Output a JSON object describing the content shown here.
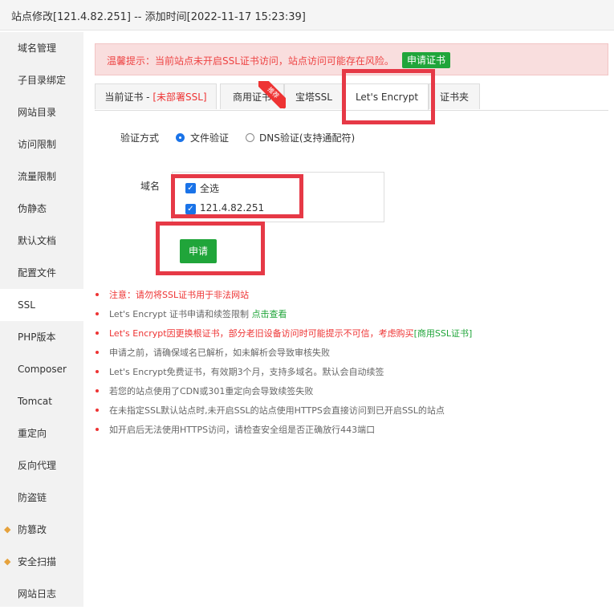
{
  "window": {
    "title": "站点修改[121.4.82.251] -- 添加时间[2022-11-17 15:23:39]"
  },
  "sidebar": {
    "items": [
      {
        "label": "域名管理"
      },
      {
        "label": "子目录绑定"
      },
      {
        "label": "网站目录"
      },
      {
        "label": "访问限制"
      },
      {
        "label": "流量限制"
      },
      {
        "label": "伪静态"
      },
      {
        "label": "默认文档"
      },
      {
        "label": "配置文件"
      },
      {
        "label": "SSL"
      },
      {
        "label": "PHP版本"
      },
      {
        "label": "Composer"
      },
      {
        "label": "Tomcat"
      },
      {
        "label": "重定向"
      },
      {
        "label": "反向代理"
      },
      {
        "label": "防盗链"
      },
      {
        "label": "防篡改"
      },
      {
        "label": "安全扫描"
      },
      {
        "label": "网站日志"
      }
    ],
    "active_index": 8
  },
  "alert": {
    "text": "温馨提示：当前站点未开启SSL证书访问，站点访问可能存在风险。",
    "button": "申请证书"
  },
  "tabs": {
    "current_prefix": "当前证书 - ",
    "current_status": "[未部署SSL]",
    "commercial": "商用证书",
    "ribbon": "推荐",
    "baota": "宝塔SSL",
    "letsencrypt": "Let's Encrypt",
    "folder": "证书夹"
  },
  "form": {
    "verify_label": "验证方式",
    "option_file": "文件验证",
    "option_dns": "DNS验证(支持通配符)",
    "domain_label": "域名",
    "select_all": "全选",
    "domain_item": "121.4.82.251",
    "apply_button": "申请"
  },
  "notes": [
    {
      "text": "注意：请勿将SSL证书用于非法网站",
      "style": "red"
    },
    {
      "text": "Let's Encrypt 证书申请和续签限制 ",
      "link": "点击查看",
      "style": "gray"
    },
    {
      "text": "Let's Encrypt因更换根证书，部分老旧设备访问时可能提示不可信，考虑购买",
      "link": "[商用SSL证书]",
      "style": "red"
    },
    {
      "text": "申请之前，请确保域名已解析，如未解析会导致审核失败",
      "style": "gray"
    },
    {
      "text": "Let's Encrypt免费证书，有效期3个月，支持多域名。默认会自动续签",
      "style": "gray"
    },
    {
      "text": "若您的站点使用了CDN或301重定向会导致续签失败",
      "style": "gray"
    },
    {
      "text": "在未指定SSL默认站点时,未开启SSL的站点使用HTTPS会直接访问到已开启SSL的站点",
      "style": "gray"
    },
    {
      "text": "如开启后无法使用HTTPS访问，请检查安全组是否正确放行443端口",
      "style": "gray"
    }
  ],
  "colors": {
    "accent_green": "#20a53a",
    "alert_red": "#e33333",
    "highlight_box": "#e63946",
    "radio_blue": "#1a73e8"
  }
}
